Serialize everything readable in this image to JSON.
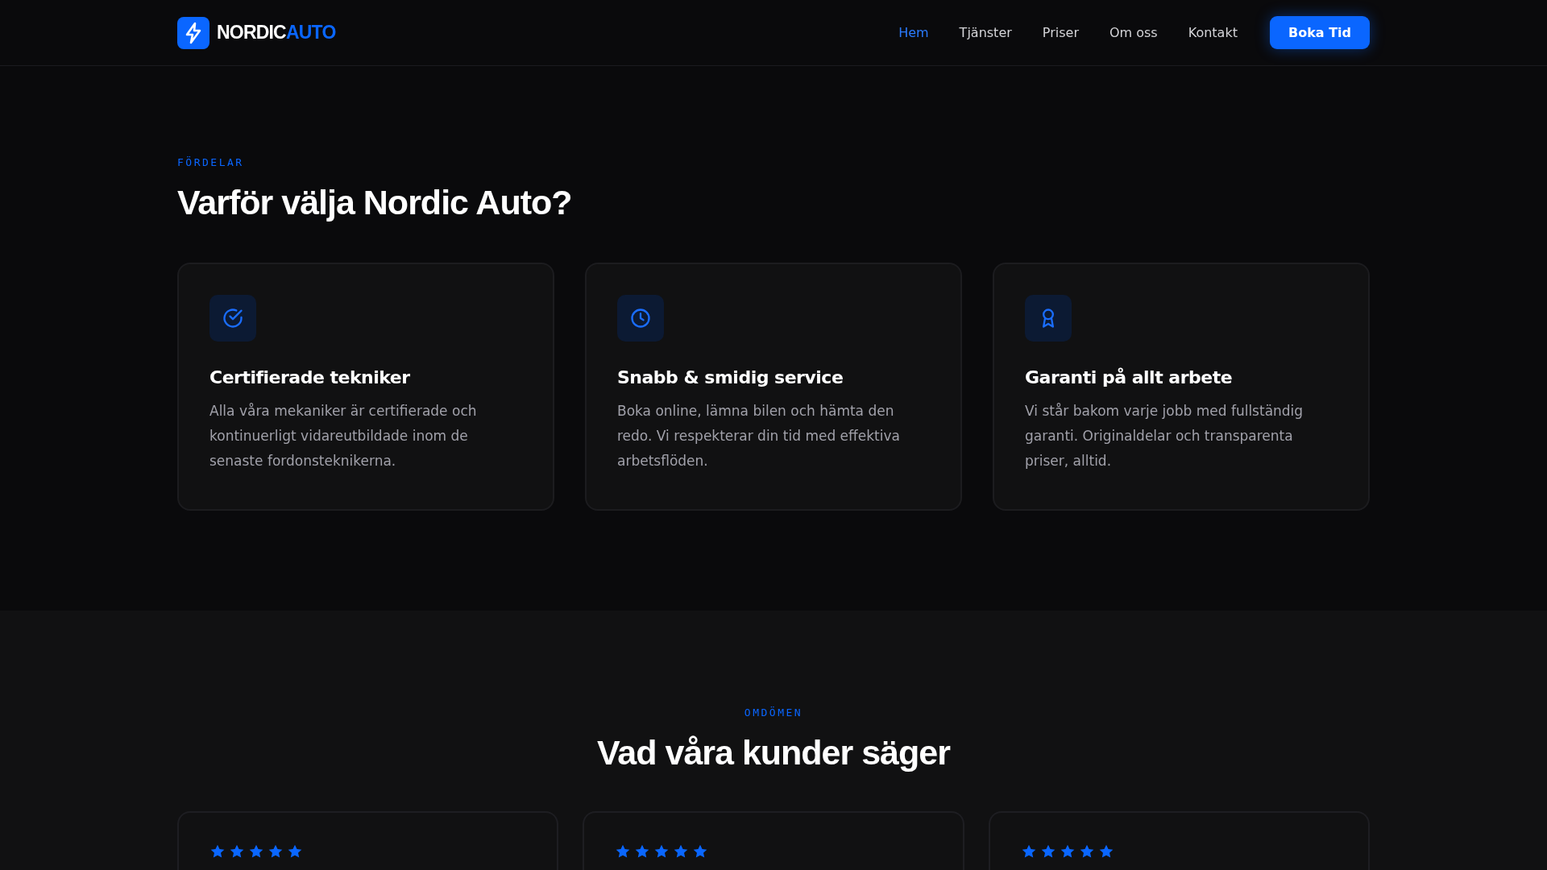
{
  "header": {
    "logo": {
      "first": "NORDIC",
      "second": "AUTO"
    },
    "nav": [
      {
        "label": "Hem",
        "selected": true
      },
      {
        "label": "Tjänster",
        "selected": false
      },
      {
        "label": "Priser",
        "selected": false
      },
      {
        "label": "Om oss",
        "selected": false
      },
      {
        "label": "Kontakt",
        "selected": false
      }
    ],
    "cta": "Boka Tid"
  },
  "features": {
    "eyebrow": "FÖRDELAR",
    "heading": "Varför välja Nordic Auto?",
    "cards": [
      {
        "kind": "check",
        "title": "Certifierade tekniker",
        "text": "Alla våra mekaniker är certifierade och kontinuerligt vidareutbildade inom de senaste fordonsteknikerna."
      },
      {
        "kind": "clock",
        "title": "Snabb & smidig service",
        "text": "Boka online, lämna bilen och hämta den redo. Vi respekterar din tid med effektiva arbetsflöden."
      },
      {
        "kind": "award",
        "title": "Garanti på allt arbete",
        "text": "Vi står bakom varje jobb med fullständig garanti. Originaldelar och transparenta priser, alltid."
      }
    ]
  },
  "reviews": {
    "eyebrow": "OMDÖMEN",
    "heading": "Vad våra kunder säger",
    "cards": [
      {
        "stars": 5
      },
      {
        "stars": 5
      },
      {
        "stars": 5
      }
    ]
  }
}
